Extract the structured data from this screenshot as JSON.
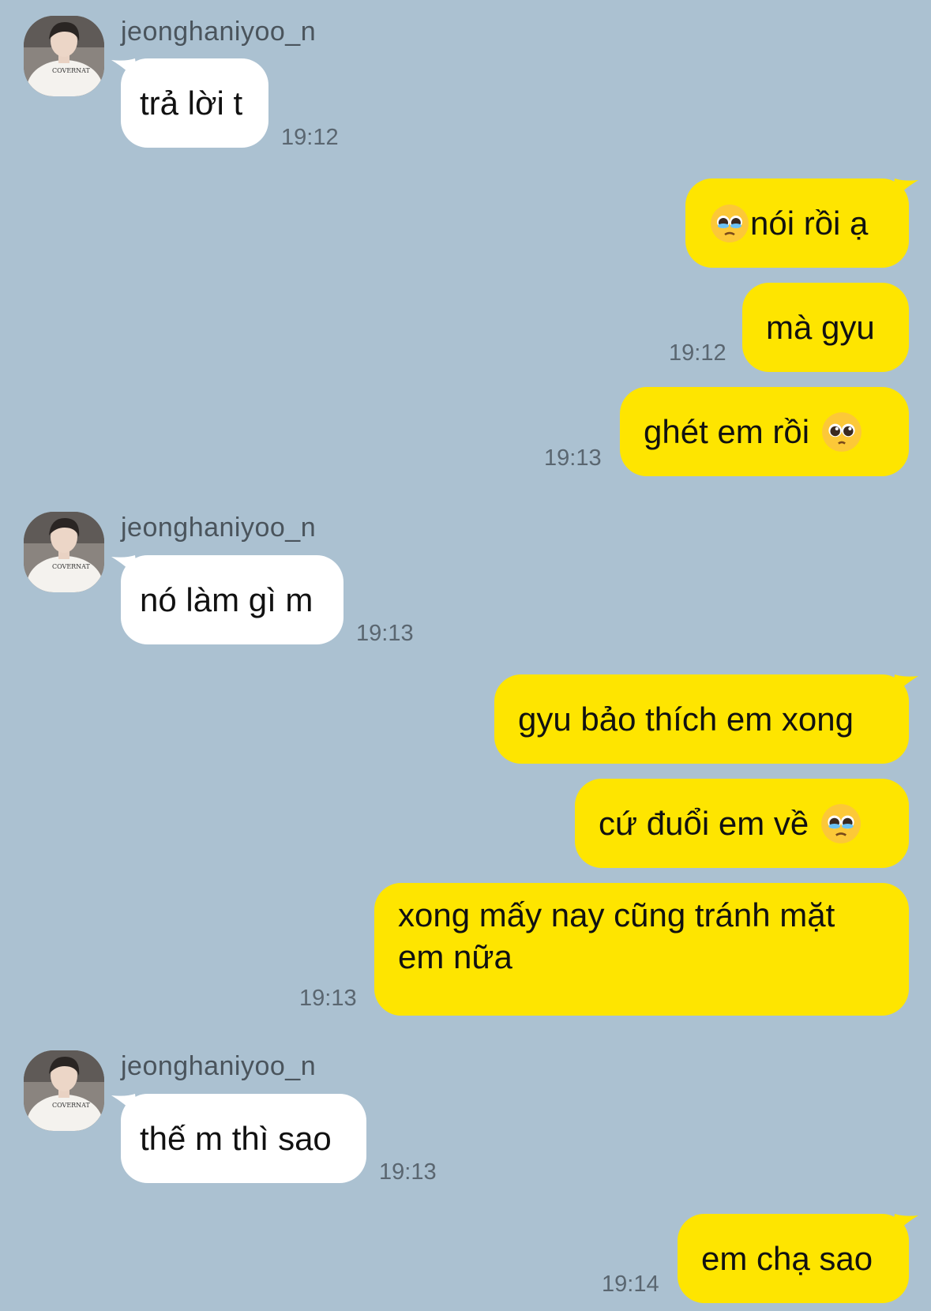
{
  "contact": {
    "name": "jeonghaniyoo_n",
    "shirt_text": "COVERNAT"
  },
  "messages": [
    {
      "id": "m1",
      "dir": "in",
      "text": "trả lời t",
      "time": "19:12"
    },
    {
      "id": "m2",
      "dir": "out",
      "text": "nói rồi ạ",
      "emoji_before": "pleading-face-teary-icon"
    },
    {
      "id": "m3",
      "dir": "out",
      "text": "mà gyu",
      "time": "19:12"
    },
    {
      "id": "m4",
      "dir": "out",
      "text": "ghét em rồi",
      "emoji_after": "pleading-face-icon",
      "time": "19:13"
    },
    {
      "id": "m5",
      "dir": "in",
      "text": "nó làm gì m",
      "time": "19:13"
    },
    {
      "id": "m6",
      "dir": "out",
      "text": "gyu bảo thích em xong"
    },
    {
      "id": "m7",
      "dir": "out",
      "text": "cứ đuổi em về",
      "emoji_after": "pleading-face-teary-icon"
    },
    {
      "id": "m8",
      "dir": "out",
      "text": "xong mấy nay cũng tránh mặt em nữa",
      "time": "19:13"
    },
    {
      "id": "m9",
      "dir": "in",
      "text": "thế m thì sao",
      "time": "19:13"
    },
    {
      "id": "m10",
      "dir": "out",
      "text": "em chạ sao",
      "time": "19:14"
    }
  ],
  "colors": {
    "background": "#abc1d1",
    "outgoing_bubble": "#fee500",
    "incoming_bubble": "#ffffff",
    "timestamp": "#5a6670"
  }
}
